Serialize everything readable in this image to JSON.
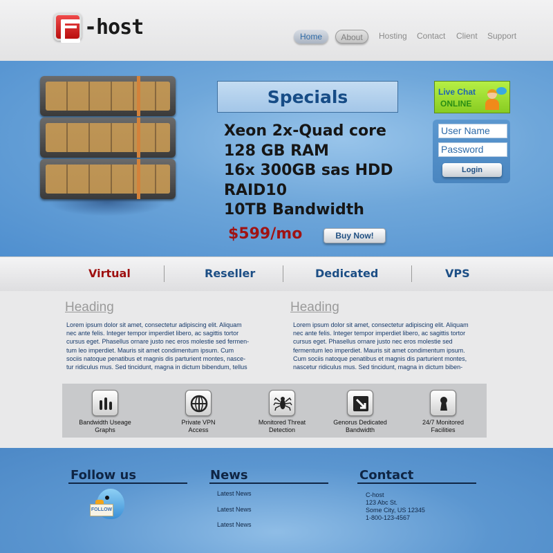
{
  "brand": {
    "logo_text": "-host",
    "accent": "#c8201e"
  },
  "nav": {
    "items": [
      "Home",
      "About",
      "Hosting",
      "Contact",
      "Client",
      "Support"
    ]
  },
  "hero": {
    "specials_title": "Specials",
    "specs": [
      "Xeon 2x-Quad core",
      "128 GB RAM",
      "16x 300GB sas HDD",
      "RAID10",
      "10TB Bandwidth"
    ],
    "price": "$599/mo",
    "buy_label": "Buy Now!"
  },
  "live_chat": {
    "line1": "Live Chat",
    "line2": "ONLINE"
  },
  "login": {
    "username_value": "User Name",
    "password_value": "Password",
    "button_label": "Login"
  },
  "categories": [
    "Virtual",
    "Reseller",
    "Dedicated",
    "VPS"
  ],
  "content": {
    "columns": [
      {
        "heading": "Heading",
        "lines": [
          "Lorem ipsum dolor sit amet, consectetur adipiscing elit. Aliquam",
          "nec ante felis. Integer tempor imperdiet libero, ac sagittis tortor",
          "cursus eget. Phasellus ornare justo nec eros molestie sed fermen-",
          "tum leo imperdiet. Mauris sit amet condimentum ipsum. Cum",
          "sociis natoque penatibus et magnis dis parturient montes, nasce-",
          "tur ridiculus mus. Sed tincidunt, magna in dictum bibendum, tellus"
        ]
      },
      {
        "heading": "Heading",
        "lines": [
          "Lorem ipsum dolor sit amet, consectetur adipiscing elit. Aliquam",
          "nec ante felis. Integer tempor imperdiet libero, ac sagittis tortor",
          "cursus eget. Phasellus ornare justo nec eros molestie sed",
          "fermentum leo imperdiet. Mauris sit amet condimentum ipsum.",
          "Cum sociis natoque penatibus et magnis dis parturient montes,",
          "nascetur ridiculus mus. Sed tincidunt, magna in dictum biben-"
        ]
      }
    ]
  },
  "features": [
    {
      "line1": "Bandwidth Useage",
      "line2": "Graphs",
      "icon": "bar-graph-icon"
    },
    {
      "line1": "Private VPN",
      "line2": "Access",
      "icon": "globe-icon"
    },
    {
      "line1": "Monitored Threat",
      "line2": "Detection",
      "icon": "spider-icon"
    },
    {
      "line1": "Genorus Dedicated",
      "line2": "Bandwidth",
      "icon": "expand-arrow-icon"
    },
    {
      "line1": "24/7 Monitored",
      "line2": "Facilities",
      "icon": "keyhole-icon"
    }
  ],
  "footer": {
    "follow_title": "Follow us",
    "follow_sign": "FOLLOW",
    "news_title": "News",
    "news_links": [
      "Latest News",
      "Latest News",
      "Latest News"
    ],
    "contact_title": "Contact",
    "contact_lines": [
      "C-host",
      "123 Abc St.",
      "Some City, US 12345",
      "1-800-123-4567"
    ]
  }
}
